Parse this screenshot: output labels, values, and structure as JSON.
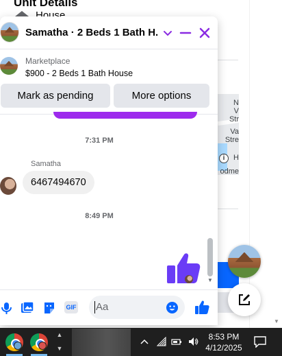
{
  "background": {
    "heading": "Unit Details",
    "house_label": "House",
    "map_labels": [
      "N",
      "V",
      "Str",
      "Va",
      "Stre",
      "H",
      "odme"
    ],
    "map_info": "i"
  },
  "chat": {
    "title": "Samatha · 2 Beds 1 Bath H...",
    "listing": {
      "source": "Marketplace",
      "item": "$900 - 2 Beds 1 Bath House"
    },
    "buttons": {
      "pending": "Mark as pending",
      "more": "More options"
    },
    "messages": {
      "time1": "7:31 PM",
      "sender": "Samatha",
      "received": "6467494670",
      "time2": "8:49 PM"
    },
    "composer": {
      "placeholder": "Aa",
      "gif_label": "GIF"
    }
  },
  "taskbar": {
    "time": "8:53 PM",
    "date": "4/12/2025"
  },
  "colors": {
    "accent": "#8a2be2",
    "like": "#7a3cff",
    "messenger_blue": "#0866ff"
  }
}
